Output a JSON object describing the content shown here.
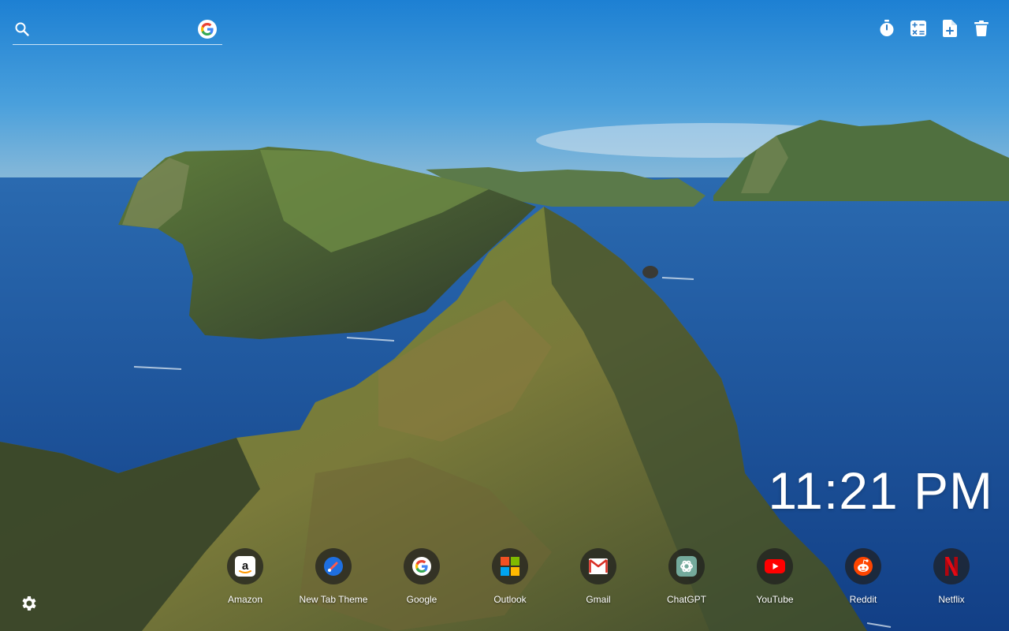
{
  "search": {
    "placeholder": "",
    "icon": "search-icon",
    "engine_icon": "google-g-icon"
  },
  "toolbar": {
    "icons": [
      "stopwatch-icon",
      "calculator-icon",
      "new-file-icon",
      "trash-icon"
    ]
  },
  "clock": {
    "time": "11:21 PM"
  },
  "shortcuts": [
    {
      "label": "Amazon",
      "icon": "amazon-icon"
    },
    {
      "label": "New Tab Theme",
      "icon": "new-tab-theme-icon"
    },
    {
      "label": "Google",
      "icon": "google-icon"
    },
    {
      "label": "Outlook",
      "icon": "outlook-icon"
    },
    {
      "label": "Gmail",
      "icon": "gmail-icon"
    },
    {
      "label": "ChatGPT",
      "icon": "chatgpt-icon"
    },
    {
      "label": "YouTube",
      "icon": "youtube-icon"
    },
    {
      "label": "Reddit",
      "icon": "reddit-icon"
    },
    {
      "label": "Netflix",
      "icon": "netflix-icon"
    }
  ],
  "settings": {
    "icon": "gear-icon"
  },
  "colors": {
    "sky_top": "#1e7fd0",
    "sky_horizon": "#8ab9d8",
    "sea": "#1d5aa0",
    "cliff_green": "#5d7a35",
    "cliff_dark": "#3a4a2a",
    "text": "#ffffff"
  }
}
